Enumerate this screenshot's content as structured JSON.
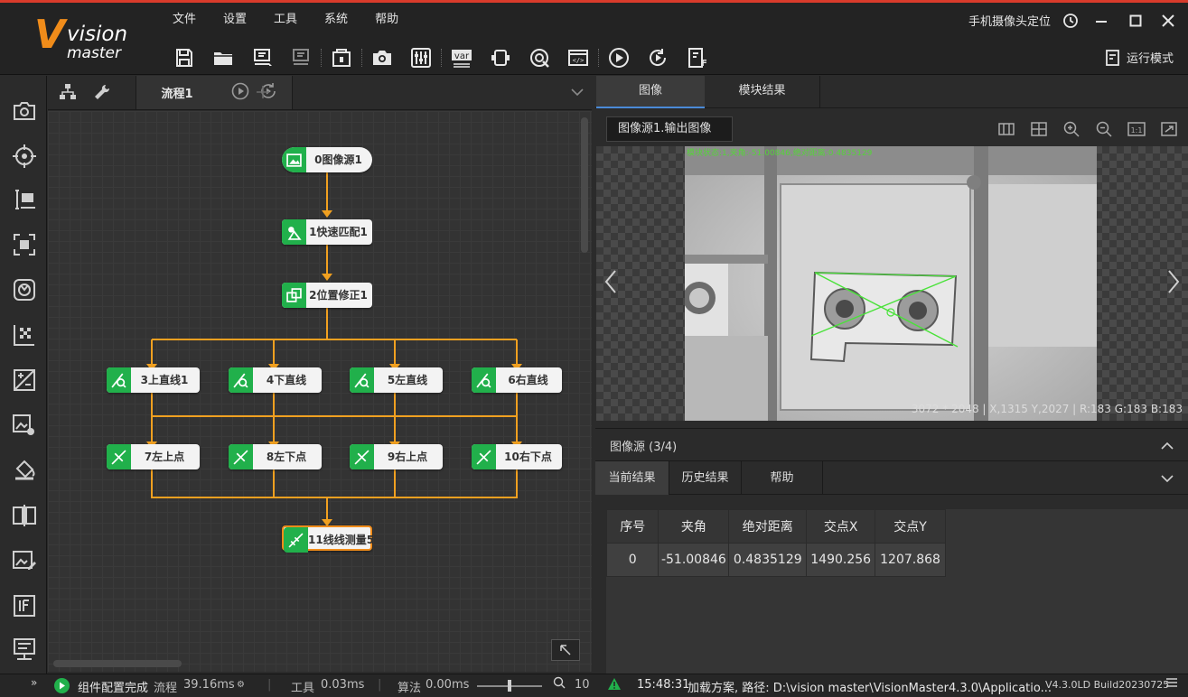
{
  "app": {
    "logo_big": "V",
    "logo_word1": "vision",
    "logo_word2": "master",
    "topright_label": "手机摄像头定位",
    "run_mode": "运行模式"
  },
  "menu": [
    "文件",
    "设置",
    "工具",
    "系统",
    "帮助"
  ],
  "flow": {
    "tab_title": "流程1",
    "nodes": [
      {
        "label": "0图像源1"
      },
      {
        "label": "1快速匹配1"
      },
      {
        "label": "2位置修正1"
      },
      {
        "label": "3上直线1"
      },
      {
        "label": "4下直线"
      },
      {
        "label": "5左直线"
      },
      {
        "label": "6右直线"
      },
      {
        "label": "7左上点"
      },
      {
        "label": "8左下点"
      },
      {
        "label": "9右上点"
      },
      {
        "label": "10右下点"
      },
      {
        "label": "11线线测量5"
      }
    ]
  },
  "right": {
    "tabs": [
      "图像",
      "模块结果"
    ],
    "image_select": "图像源1.输出图像",
    "status_overlay": "模块状态:1,夹角:-51.00846,绝对距离:0.4835129",
    "pixel_info": "3072 * 2048  |  X,1315  Y,2027  |  R:183  G:183  B:183",
    "section_title": "图像源 (3/4)",
    "result_tabs": [
      "当前结果",
      "历史结果",
      "帮助"
    ],
    "table": {
      "headers": [
        "序号",
        "夹角",
        "绝对距离",
        "交点X",
        "交点Y"
      ],
      "rows": [
        [
          "0",
          "-51.00846",
          "0.4835129",
          "1490.256",
          "1207.868"
        ]
      ]
    }
  },
  "status": {
    "config_done": "组件配置完成",
    "flow_label": "流程",
    "flow_time": "39.16ms",
    "tool_label": "工具",
    "tool_time": "0.03ms",
    "algo_label": "算法",
    "algo_time": "0.00ms",
    "zoom_value": "10",
    "log_time": "15:48:31",
    "log_text": "加载方案, 路径: D:\\vision master\\VisionMaster4.3.0\\Applicatio...",
    "version": "V4.3.0LD Build20230725"
  },
  "colors": {
    "accent_orange": "#f08c1a",
    "node_green": "#21b04b",
    "tab_blue": "#4a8ad8"
  }
}
